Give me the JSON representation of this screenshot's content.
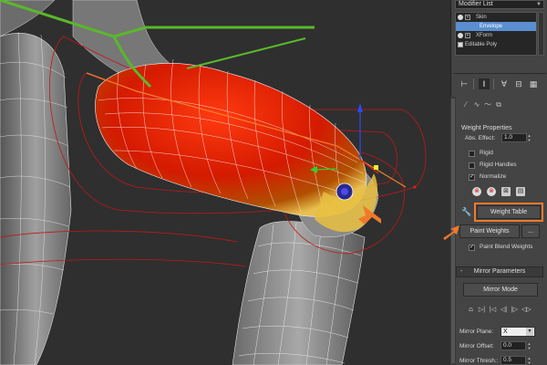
{
  "modifier_panel": {
    "modifier_list_label": "Modifier List",
    "stack": [
      {
        "label": "Skin",
        "box": "+"
      },
      {
        "label": "Envelope",
        "selected": true
      },
      {
        "label": "XForm",
        "box": "+"
      },
      {
        "label": "Editable Poly"
      }
    ]
  },
  "weight_properties": {
    "title": "Weight Properties",
    "abs_effect_label": "Abs. Effect:",
    "abs_effect_value": "1.0",
    "rigid_label": "Rigid",
    "rigid_handles_label": "Rigid Handles",
    "normalize_label": "Normalize",
    "normalize_checked": true,
    "weight_table_label": "Weight Table",
    "paint_weights_label": "Paint Weights",
    "paint_options_label": "...",
    "paint_blend_label": "Paint Blend Weights",
    "paint_blend_checked": true
  },
  "mirror_parameters": {
    "collapse_symbol": "-",
    "title": "Mirror Parameters",
    "mirror_mode_label": "Mirror Mode",
    "mirror_plane_label": "Mirror Plane:",
    "mirror_plane_value": "X",
    "mirror_offset_label": "Mirror Offset:",
    "mirror_offset_value": "0.0",
    "mirror_thresh_label": "Mirror Thresh.:",
    "mirror_thresh_value": "0.5"
  },
  "colors": {
    "highlight": "#f07a2a",
    "selection": "#5b8ed0",
    "envelope_red": "#d41a00",
    "bone_green": "#5ab82a"
  }
}
